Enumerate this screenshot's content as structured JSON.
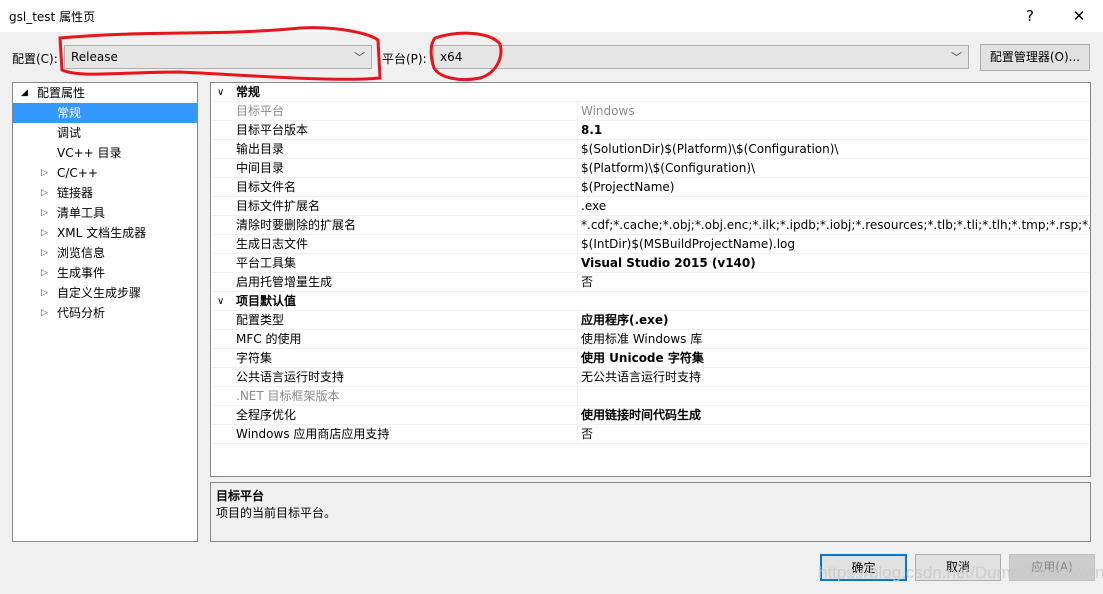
{
  "window": {
    "title": "gsl_test 属性页",
    "help": "?",
    "close": "✕"
  },
  "config": {
    "label": "配置(C):",
    "value": "Release"
  },
  "platform": {
    "label": "平台(P):",
    "value": "x64"
  },
  "config_manager": "配置管理器(O)...",
  "tree": {
    "root": "配置属性",
    "items": [
      {
        "label": "常规",
        "selected": true,
        "expandable": false
      },
      {
        "label": "调试",
        "expandable": false
      },
      {
        "label": "VC++ 目录",
        "expandable": false
      },
      {
        "label": "C/C++",
        "expandable": true
      },
      {
        "label": "链接器",
        "expandable": true
      },
      {
        "label": "清单工具",
        "expandable": true
      },
      {
        "label": "XML 文档生成器",
        "expandable": true
      },
      {
        "label": "浏览信息",
        "expandable": true
      },
      {
        "label": "生成事件",
        "expandable": true
      },
      {
        "label": "自定义生成步骤",
        "expandable": true
      },
      {
        "label": "代码分析",
        "expandable": true
      }
    ]
  },
  "grid": {
    "sections": [
      {
        "title": "常规",
        "rows": [
          {
            "name": "目标平台",
            "value": "Windows",
            "disabled": true
          },
          {
            "name": "目标平台版本",
            "value": "8.1",
            "bold": true
          },
          {
            "name": "输出目录",
            "value": "$(SolutionDir)$(Platform)\\$(Configuration)\\"
          },
          {
            "name": "中间目录",
            "value": "$(Platform)\\$(Configuration)\\"
          },
          {
            "name": "目标文件名",
            "value": "$(ProjectName)"
          },
          {
            "name": "目标文件扩展名",
            "value": ".exe"
          },
          {
            "name": "清除时要删除的扩展名",
            "value": "*.cdf;*.cache;*.obj;*.obj.enc;*.ilk;*.ipdb;*.iobj;*.resources;*.tlb;*.tli;*.tlh;*.tmp;*.rsp;*.pgc;*.pgd"
          },
          {
            "name": "生成日志文件",
            "value": "$(IntDir)$(MSBuildProjectName).log"
          },
          {
            "name": "平台工具集",
            "value": "Visual Studio 2015 (v140)",
            "bold": true
          },
          {
            "name": "启用托管增量生成",
            "value": "否"
          }
        ]
      },
      {
        "title": "项目默认值",
        "rows": [
          {
            "name": "配置类型",
            "value": "应用程序(.exe)",
            "bold": true
          },
          {
            "name": "MFC 的使用",
            "value": "使用标准 Windows 库"
          },
          {
            "name": "字符集",
            "value": "使用 Unicode 字符集",
            "bold": true
          },
          {
            "name": "公共语言运行时支持",
            "value": "无公共语言运行时支持"
          },
          {
            "name": ".NET 目标框架版本",
            "value": "",
            "disabled": true
          },
          {
            "name": "全程序优化",
            "value": "使用链接时间代码生成",
            "bold": true
          },
          {
            "name": "Windows 应用商店应用支持",
            "value": "否"
          }
        ]
      }
    ]
  },
  "description": {
    "title": "目标平台",
    "text": "项目的当前目标平台。"
  },
  "buttons": {
    "ok": "确定",
    "cancel": "取消",
    "apply": "应用(A)"
  },
  "watermark": "https://blog.csdn.net/DumpDoctorWang",
  "annotation_color": "#e8151d"
}
